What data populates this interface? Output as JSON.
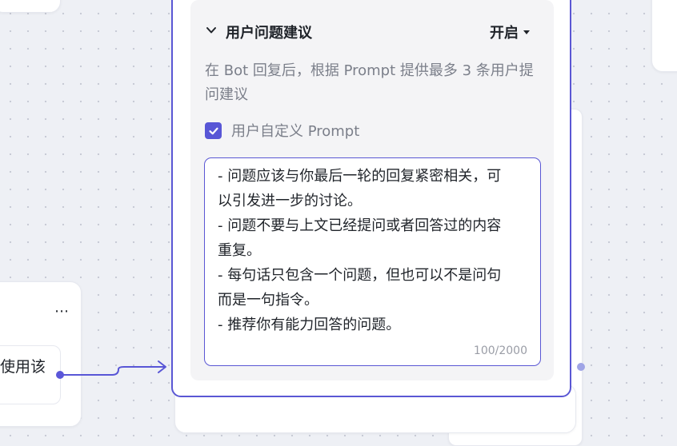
{
  "colors": {
    "accent": "#5856d6",
    "canvas": "#eef0f5",
    "section_bg": "#f4f4f6",
    "muted_text": "#7b7f8a"
  },
  "left_node": {
    "more_icon": "more-horizontal-icon",
    "item_text": "使用该"
  },
  "suggestion_panel": {
    "title": "用户问题建议",
    "toggle_value": "开启",
    "description": "在 Bot 回复后，根据 Prompt 提供最多 3 条用户提问建议",
    "custom_prompt_checked": true,
    "custom_prompt_label": "用户自定义 Prompt",
    "prompt_lines": [
      "- 问题应该与你最后一轮的回复紧密相关，可",
      "以引发进一步的讨论。",
      "- 问题不要与上文已经提问或者回答过的内容",
      "重复。",
      "- 每句话只包含一个问题，但也可以不是问句",
      "而是一句指令。",
      "- 推荐你有能力回答的问题。"
    ],
    "char_count": "100/2000"
  }
}
